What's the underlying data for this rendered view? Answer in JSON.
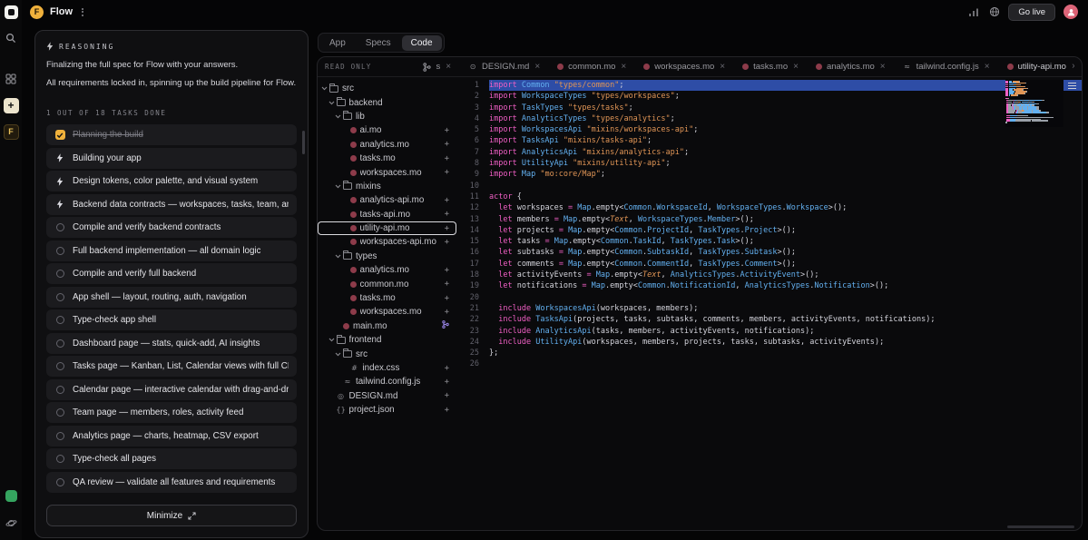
{
  "rail": {
    "app_letter": "F"
  },
  "topbar": {
    "app_letter": "F",
    "title": "Flow",
    "go_live_label": "Go live"
  },
  "reasoning": {
    "header_label": "REASONING",
    "paragraphs": [
      "Finalizing the full spec for Flow with your answers.",
      "All requirements locked in, spinning up the build pipeline for Flow."
    ],
    "progress_label": "1 OUT OF 18 TASKS DONE",
    "tasks": [
      {
        "label": "Planning the build",
        "state": "done"
      },
      {
        "label": "Building your app",
        "state": "active"
      },
      {
        "label": "Design tokens, color palette, and visual system",
        "state": "active"
      },
      {
        "label": "Backend data contracts — workspaces, tasks, team, analytics",
        "state": "active"
      },
      {
        "label": "Compile and verify backend contracts",
        "state": "pending"
      },
      {
        "label": "Full backend implementation — all domain logic",
        "state": "pending"
      },
      {
        "label": "Compile and verify full backend",
        "state": "pending"
      },
      {
        "label": "App shell — layout, routing, auth, navigation",
        "state": "pending"
      },
      {
        "label": "Type-check app shell",
        "state": "pending"
      },
      {
        "label": "Dashboard page — stats, quick-add, AI insights",
        "state": "pending"
      },
      {
        "label": "Tasks page — Kanban, List, Calendar views with full CRUD",
        "state": "pending"
      },
      {
        "label": "Calendar page — interactive calendar with drag-and-drop",
        "state": "pending"
      },
      {
        "label": "Team page — members, roles, activity feed",
        "state": "pending"
      },
      {
        "label": "Analytics page — charts, heatmap, CSV export",
        "state": "pending"
      },
      {
        "label": "Type-check all pages",
        "state": "pending"
      },
      {
        "label": "QA review — validate all features and requirements",
        "state": "pending"
      }
    ],
    "minimize_label": "Minimize"
  },
  "main": {
    "tabs": [
      {
        "label": "App"
      },
      {
        "label": "Specs"
      },
      {
        "label": "Code"
      }
    ],
    "active_tab": "Code",
    "filebar": {
      "read_only_label": "READ ONLY",
      "tabs": [
        {
          "label": "s",
          "icon": "branch"
        },
        {
          "label": "DESIGN.md",
          "icon": "md"
        },
        {
          "label": "common.mo",
          "icon": "mo"
        },
        {
          "label": "workspaces.mo",
          "icon": "mo"
        },
        {
          "label": "tasks.mo",
          "icon": "mo"
        },
        {
          "label": "analytics.mo",
          "icon": "mo"
        },
        {
          "label": "tailwind.config.js",
          "icon": "js"
        },
        {
          "label": "utility-api.mo",
          "icon": "mo",
          "active": true
        }
      ]
    },
    "tree": [
      {
        "name": "src",
        "type": "folder",
        "depth": 0
      },
      {
        "name": "backend",
        "type": "folder",
        "depth": 1
      },
      {
        "name": "lib",
        "type": "folder",
        "depth": 2
      },
      {
        "name": "ai.mo",
        "type": "mo",
        "depth": 3,
        "marker": "added"
      },
      {
        "name": "analytics.mo",
        "type": "mo",
        "depth": 3,
        "marker": "added"
      },
      {
        "name": "tasks.mo",
        "type": "mo",
        "depth": 3,
        "marker": "added"
      },
      {
        "name": "workspaces.mo",
        "type": "mo",
        "depth": 3,
        "marker": "added"
      },
      {
        "name": "mixins",
        "type": "folder",
        "depth": 2
      },
      {
        "name": "analytics-api.mo",
        "type": "mo",
        "depth": 3,
        "marker": "added"
      },
      {
        "name": "tasks-api.mo",
        "type": "mo",
        "depth": 3,
        "marker": "added"
      },
      {
        "name": "utility-api.mo",
        "type": "mo",
        "depth": 3,
        "marker": "added",
        "selected": true
      },
      {
        "name": "workspaces-api.mo",
        "type": "mo",
        "depth": 3,
        "marker": "added"
      },
      {
        "name": "types",
        "type": "folder",
        "depth": 2
      },
      {
        "name": "analytics.mo",
        "type": "mo",
        "depth": 3,
        "marker": "added"
      },
      {
        "name": "common.mo",
        "type": "mo",
        "depth": 3,
        "marker": "added"
      },
      {
        "name": "tasks.mo",
        "type": "mo",
        "depth": 3,
        "marker": "added"
      },
      {
        "name": "workspaces.mo",
        "type": "mo",
        "depth": 3,
        "marker": "added"
      },
      {
        "name": "main.mo",
        "type": "mo",
        "depth": 2,
        "marker": "branch"
      },
      {
        "name": "frontend",
        "type": "folder",
        "depth": 1
      },
      {
        "name": "src",
        "type": "folder",
        "depth": 2
      },
      {
        "name": "index.css",
        "type": "css",
        "depth": 3,
        "marker": "added"
      },
      {
        "name": "tailwind.config.js",
        "type": "js",
        "depth": 2,
        "marker": "added"
      },
      {
        "name": "DESIGN.md",
        "type": "md",
        "depth": 1,
        "marker": "added"
      },
      {
        "name": "project.json",
        "type": "json",
        "depth": 1,
        "marker": "added"
      }
    ],
    "editor": {
      "selected_line": 1,
      "code": [
        "import Common \"types/common\";",
        "import WorkspaceTypes \"types/workspaces\";",
        "import TaskTypes \"types/tasks\";",
        "import AnalyticsTypes \"types/analytics\";",
        "import WorkspacesApi \"mixins/workspaces-api\";",
        "import TasksApi \"mixins/tasks-api\";",
        "import AnalyticsApi \"mixins/analytics-api\";",
        "import UtilityApi \"mixins/utility-api\";",
        "import Map \"mo:core/Map\";",
        "",
        "actor {",
        "  let workspaces = Map.empty<Common.WorkspaceId, WorkspaceTypes.Workspace>();",
        "  let members = Map.empty<Text, WorkspaceTypes.Member>();",
        "  let projects = Map.empty<Common.ProjectId, TaskTypes.Project>();",
        "  let tasks = Map.empty<Common.TaskId, TaskTypes.Task>();",
        "  let subtasks = Map.empty<Common.SubtaskId, TaskTypes.Subtask>();",
        "  let comments = Map.empty<Common.CommentId, TaskTypes.Comment>();",
        "  let activityEvents = Map.empty<Text, AnalyticsTypes.ActivityEvent>();",
        "  let notifications = Map.empty<Common.NotificationId, AnalyticsTypes.Notification>();",
        "",
        "  include WorkspacesApi(workspaces, members);",
        "  include TasksApi(projects, tasks, subtasks, comments, members, activityEvents, notifications);",
        "  include AnalyticsApi(tasks, members, activityEvents, notifications);",
        "  include UtilityApi(workspaces, members, projects, tasks, subtasks, activityEvents);",
        "};",
        ""
      ]
    }
  },
  "colors": {
    "accent_amber": "#f0b13c",
    "avatar_pink": "#d95c6e",
    "keyword": "#f05fc5",
    "string": "#e09556",
    "type": "#63b0f0",
    "selection": "#2e4da6"
  }
}
